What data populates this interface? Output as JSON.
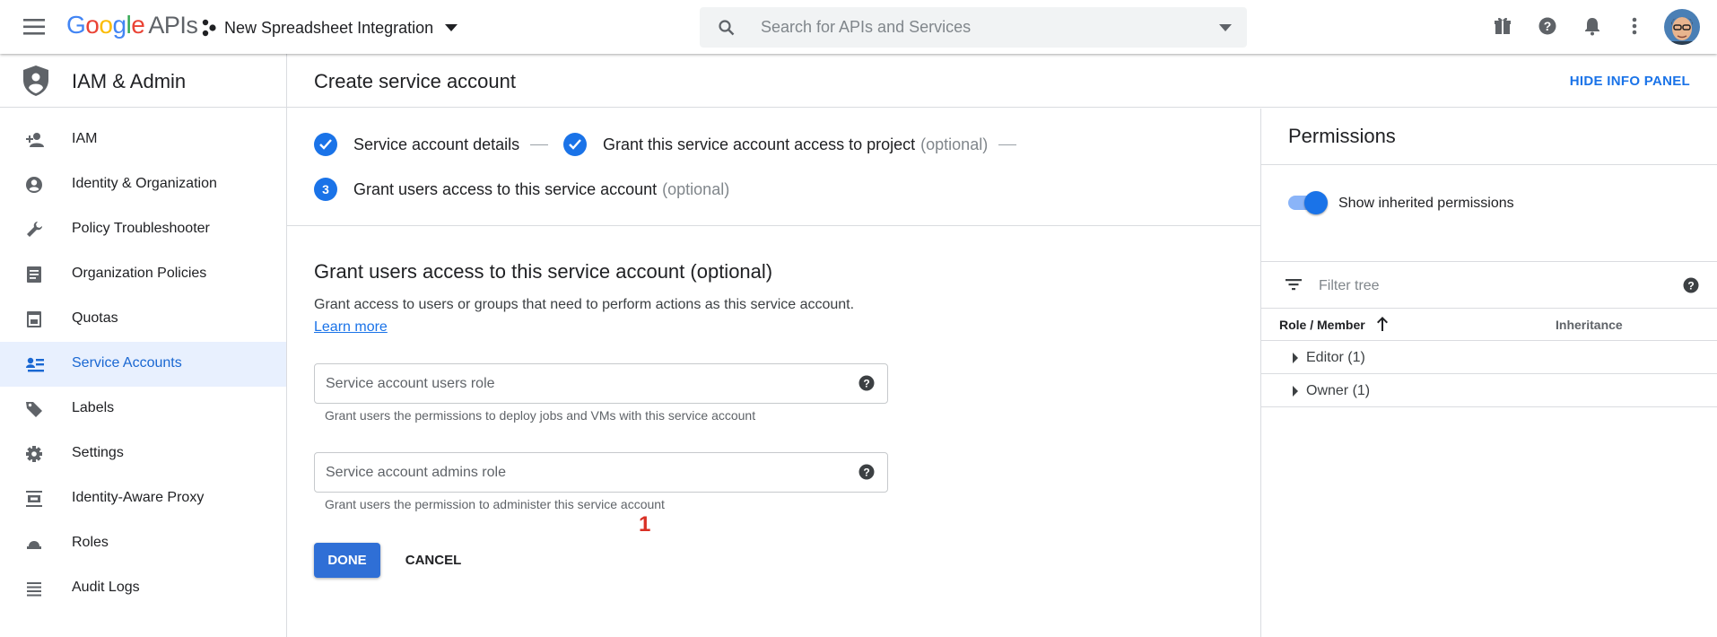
{
  "topbar": {
    "logo_letters": [
      "G",
      "o",
      "o",
      "g",
      "l",
      "e"
    ],
    "logo_suffix": "APIs",
    "project_name": "New Spreadsheet Integration",
    "search_placeholder": "Search for APIs and Services",
    "icons": [
      "menu-icon",
      "project-icon",
      "search-icon",
      "gift-icon",
      "help-icon",
      "notifications-icon",
      "more-vert-icon",
      "avatar"
    ]
  },
  "sidebar": {
    "title": "IAM & Admin",
    "items": [
      {
        "label": "IAM",
        "icon": "person-add-icon",
        "active": false
      },
      {
        "label": "Identity & Organization",
        "icon": "account-circle-icon",
        "active": false
      },
      {
        "label": "Policy Troubleshooter",
        "icon": "wrench-icon",
        "active": false
      },
      {
        "label": "Organization Policies",
        "icon": "document-icon",
        "active": false
      },
      {
        "label": "Quotas",
        "icon": "quota-icon",
        "active": false
      },
      {
        "label": "Service Accounts",
        "icon": "service-account-icon",
        "active": true
      },
      {
        "label": "Labels",
        "icon": "label-icon",
        "active": false
      },
      {
        "label": "Settings",
        "icon": "gear-icon",
        "active": false
      },
      {
        "label": "Identity-Aware Proxy",
        "icon": "proxy-icon",
        "active": false
      },
      {
        "label": "Roles",
        "icon": "roles-icon",
        "active": false
      },
      {
        "label": "Audit Logs",
        "icon": "list-icon",
        "active": false
      }
    ]
  },
  "content_header": {
    "title": "Create service account",
    "hide_panel_label": "HIDE INFO PANEL"
  },
  "stepper": {
    "step1": "Service account details",
    "step2": "Grant this service account access to project",
    "step2_optional": "(optional)",
    "step3_number": "3",
    "step3": "Grant users access to this service account",
    "step3_optional": "(optional)"
  },
  "form": {
    "section_title": "Grant users access to this service account (optional)",
    "description": "Grant access to users or groups that need to perform actions as this service account.",
    "learn_more": "Learn more",
    "users_role_placeholder": "Service account users role",
    "users_role_hint": "Grant users the permissions to deploy jobs and VMs with this service account",
    "admins_role_placeholder": "Service account admins role",
    "admins_role_hint": "Grant users the permission to administer this service account",
    "marker": "1",
    "done_label": "DONE",
    "cancel_label": "CANCEL"
  },
  "info_panel": {
    "title": "Permissions",
    "toggle_label": "Show inherited permissions",
    "toggle_on": true,
    "filter_placeholder": "Filter tree",
    "col_role": "Role / Member",
    "col_inheritance": "Inheritance",
    "rows": [
      "Editor (1)",
      "Owner (1)"
    ]
  },
  "colors": {
    "accent": "#1a73e8",
    "active_bg": "#e8f0fe",
    "marker": "#d93025"
  }
}
